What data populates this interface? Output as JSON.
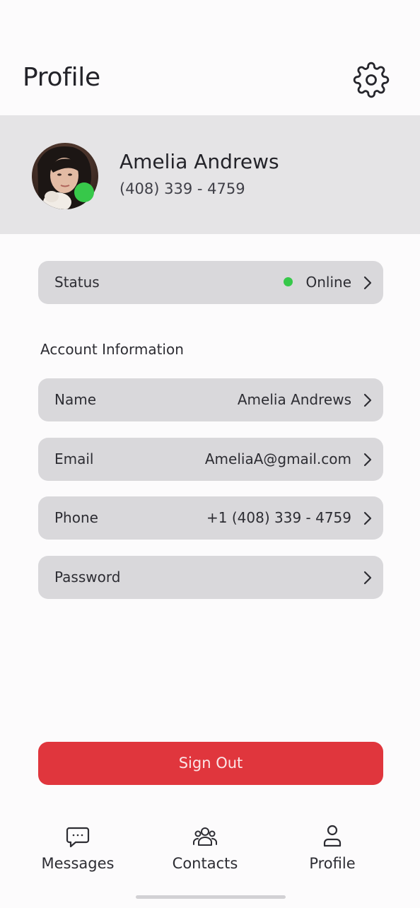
{
  "header": {
    "title": "Profile",
    "settings_icon": "gear-icon"
  },
  "profile": {
    "name": "Amelia Andrews",
    "phone": "(408) 339 - 4759",
    "presence_color": "#37c84a"
  },
  "status_row": {
    "label": "Status",
    "value": "Online",
    "indicator_color": "#37c84a"
  },
  "account": {
    "section_title": "Account Information",
    "rows": [
      {
        "label": "Name",
        "value": "Amelia Andrews"
      },
      {
        "label": "Email",
        "value": "AmeliaA@gmail.com"
      },
      {
        "label": "Phone",
        "value": "+1 (408) 339 - 4759"
      },
      {
        "label": "Password",
        "value": ""
      }
    ]
  },
  "sign_out": {
    "label": "Sign Out",
    "color": "#e0363d"
  },
  "tabs": [
    {
      "label": "Messages",
      "icon": "message-bubble-icon"
    },
    {
      "label": "Contacts",
      "icon": "contacts-icon"
    },
    {
      "label": "Profile",
      "icon": "person-icon"
    }
  ]
}
